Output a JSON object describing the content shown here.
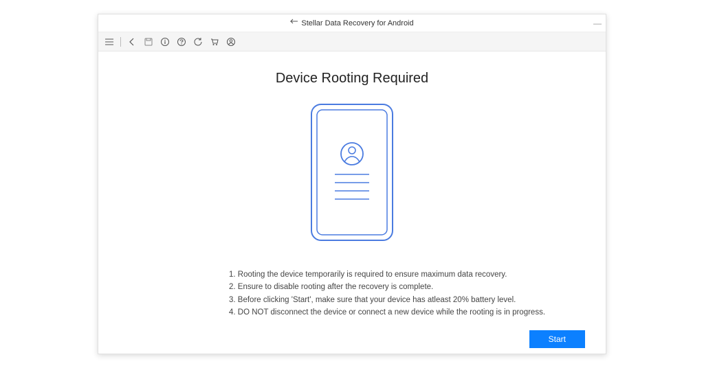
{
  "titlebar": {
    "app_title": "Stellar Data Recovery for Android"
  },
  "main": {
    "heading": "Device Rooting Required",
    "instructions": [
      "1. Rooting the device temporarily is required to ensure maximum data recovery.",
      "2. Ensure to disable rooting after the recovery is complete.",
      "3. Before clicking 'Start', make sure that your device has atleast 20% battery level.",
      "4. DO NOT disconnect the device or connect a new device while the rooting is in progress."
    ],
    "start_label": "Start"
  },
  "colors": {
    "accent": "#0c80ff",
    "phone_outline": "#4a7be0"
  }
}
